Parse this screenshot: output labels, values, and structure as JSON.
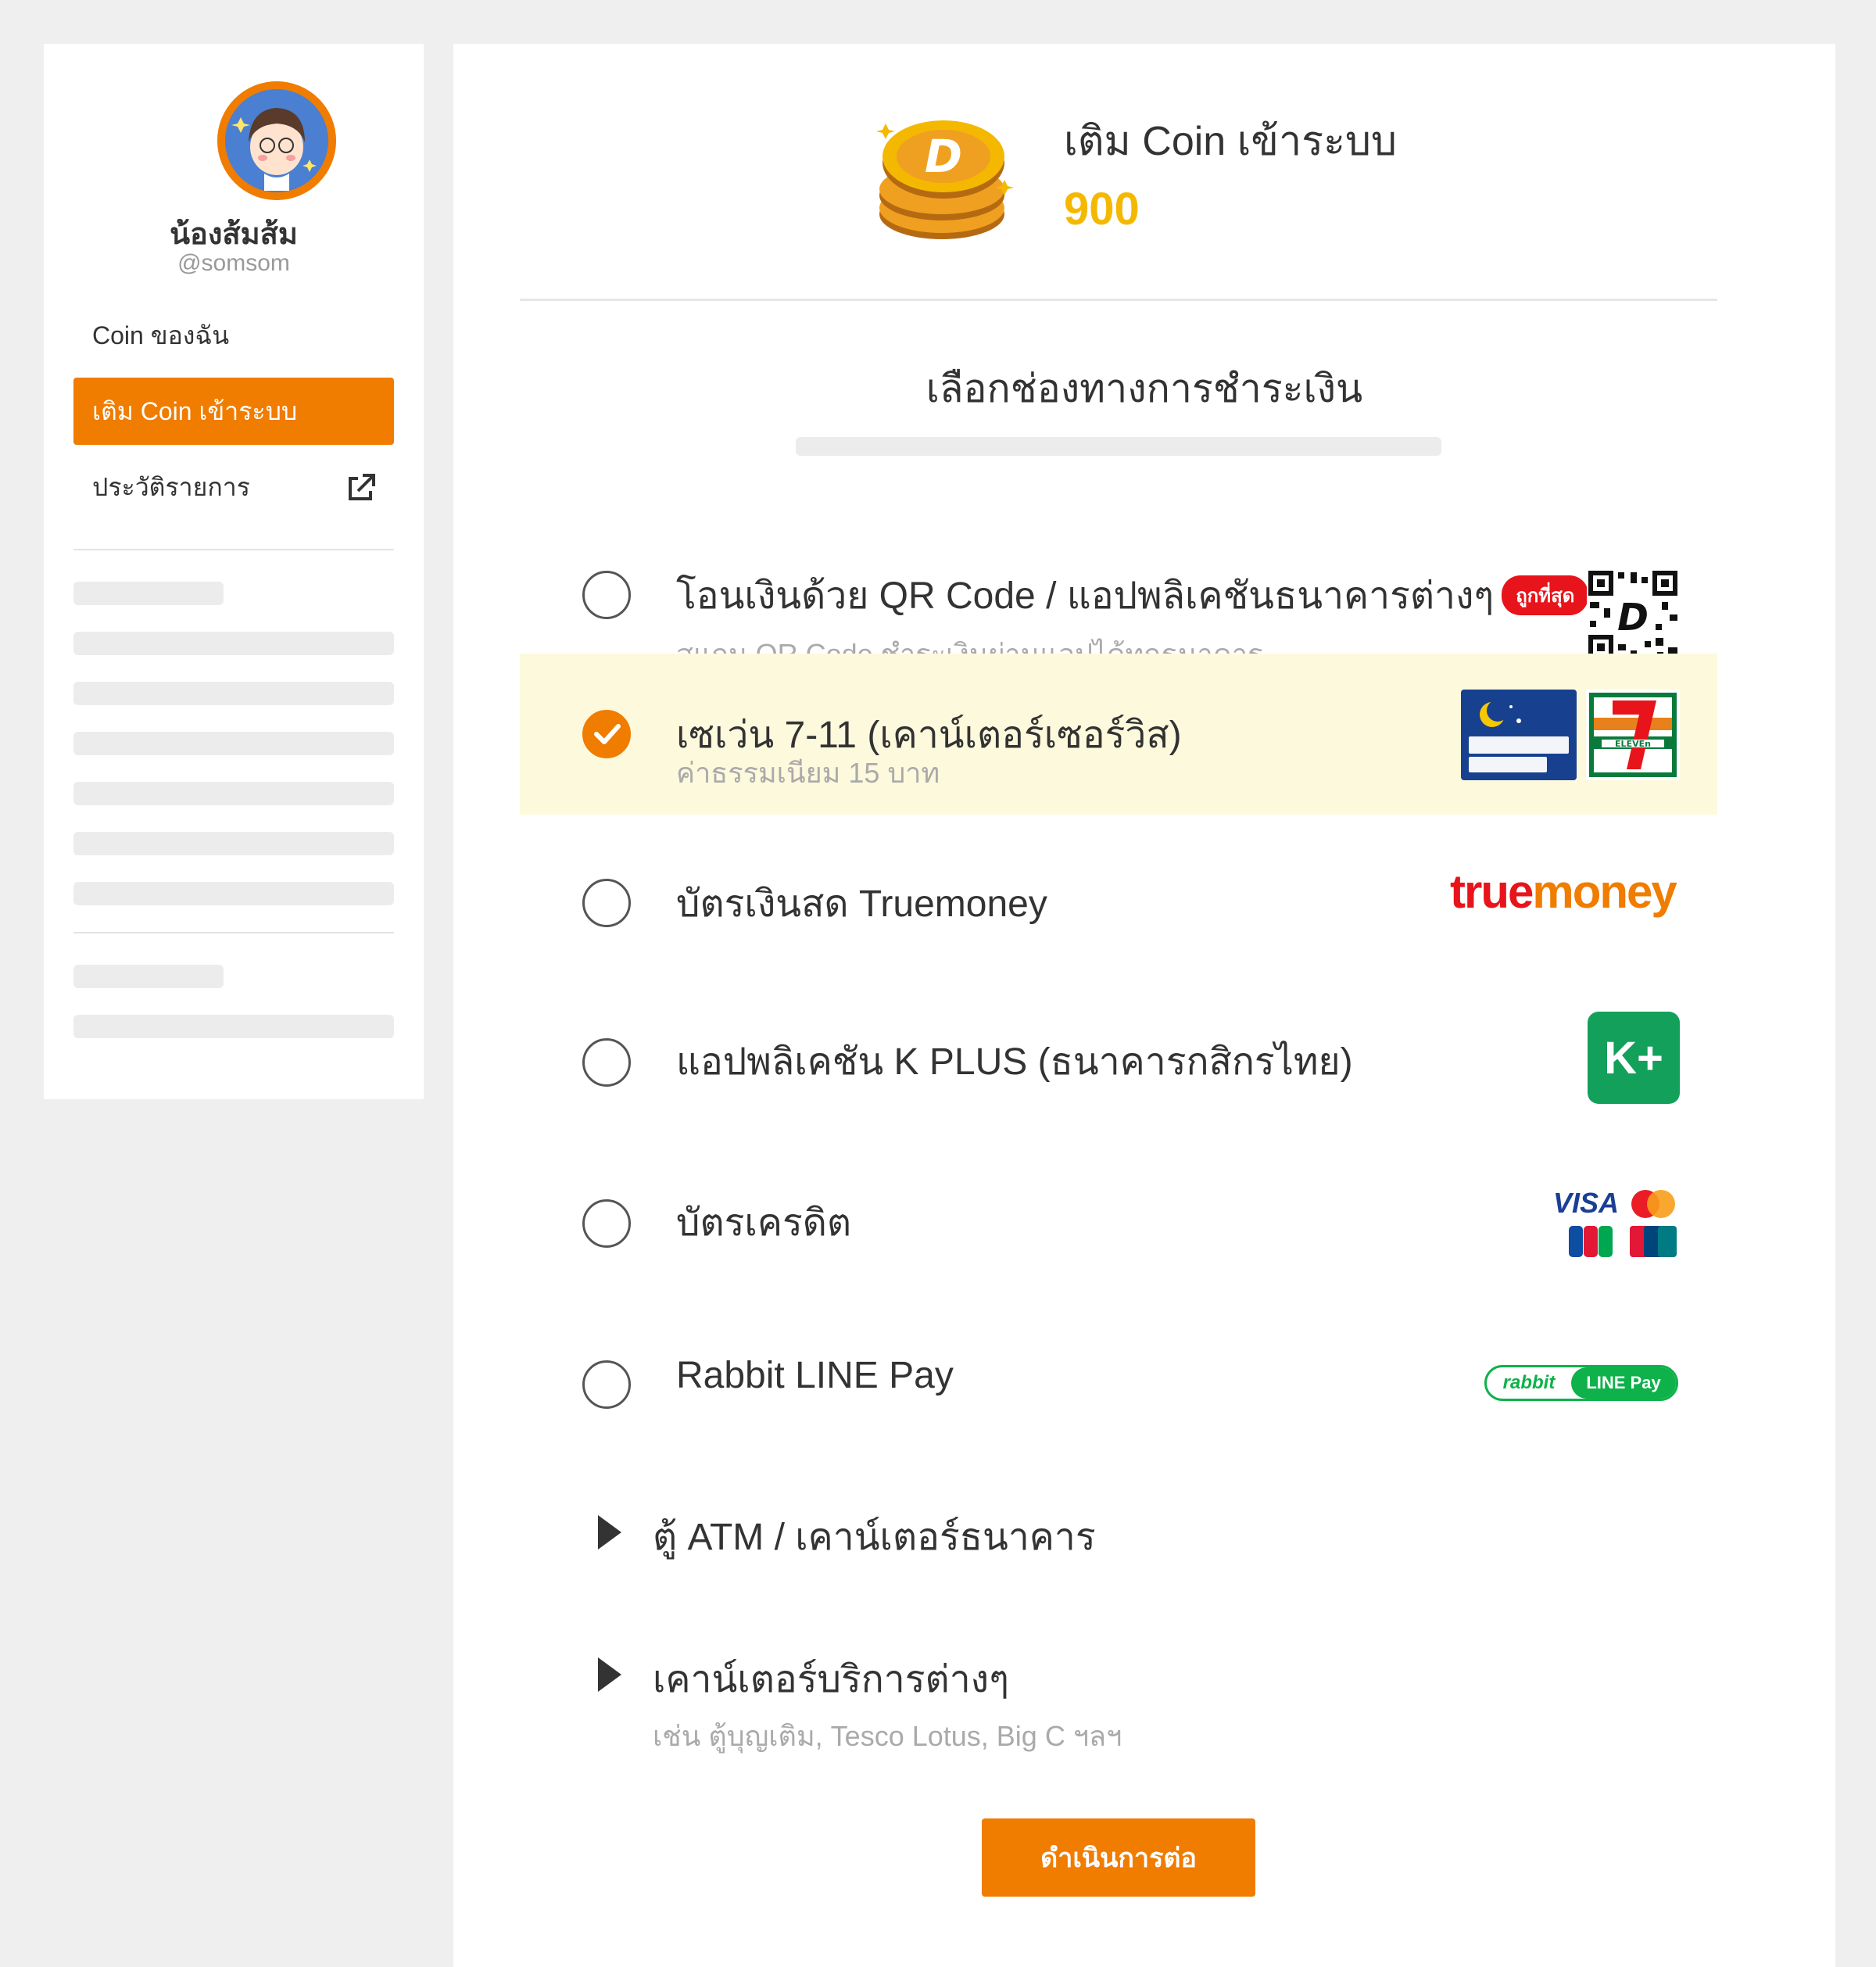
{
  "profile": {
    "name": "น้องส้มส้ม",
    "handle": "@somsom"
  },
  "sidebar": {
    "items": [
      {
        "label": "Coin ของฉัน",
        "active": false
      },
      {
        "label": "เติม Coin เข้าระบบ",
        "active": true
      },
      {
        "label": "ประวัติรายการ",
        "active": false,
        "icon": "external-link-icon"
      }
    ]
  },
  "topup": {
    "title": "เติม Coin เข้าระบบ",
    "amount": "900"
  },
  "payment": {
    "section_title": "เลือกช่องทางการชำระเงิน",
    "options": [
      {
        "label": "โอนเงินด้วย QR Code / แอปพลิเคชันธนาคารต่างๆ",
        "badge": "ถูกที่สุด",
        "sub": "สแกน QR Code ชำระเงินผ่านแอปได้ทุกธนาคาร",
        "logo": "qr-code-icon",
        "selected": false
      },
      {
        "label": "เซเว่น 7-11 (เคาน์เตอร์เซอร์วิส)",
        "sub": "ค่าธรรมเนียม 15 บาท",
        "logo": "seven-eleven-logo",
        "selected": true
      },
      {
        "label": "บัตรเงินสด Truemoney",
        "logo": "truemoney-logo",
        "logo_text_1": "true",
        "logo_text_2": "money",
        "selected": false
      },
      {
        "label": "แอปพลิเคชัน K PLUS (ธนาคารกสิกรไทย)",
        "logo": "kplus-logo",
        "logo_text": "K+",
        "selected": false
      },
      {
        "label": "บัตรเครดิต",
        "logo": "credit-card-logos",
        "logo_text": "VISA",
        "selected": false
      },
      {
        "label": "Rabbit LINE Pay",
        "logo": "rabbit-line-pay-logo",
        "logo_text_1": "rabbit",
        "logo_text_2": "LINE Pay",
        "selected": false
      }
    ],
    "expandable": [
      {
        "label": "ตู้ ATM / เคาน์เตอร์ธนาคาร"
      },
      {
        "label": "เคาน์เตอร์บริการต่างๆ",
        "sub": "เช่น ตู้บุญเติม, Tesco Lotus, Big C ฯลฯ"
      }
    ],
    "continue_label": "ดำเนินการต่อ"
  },
  "colors": {
    "accent": "#f07c00",
    "amount": "#f5b800",
    "selected_bg": "#fdf9dc",
    "badge": "#e8141b"
  }
}
